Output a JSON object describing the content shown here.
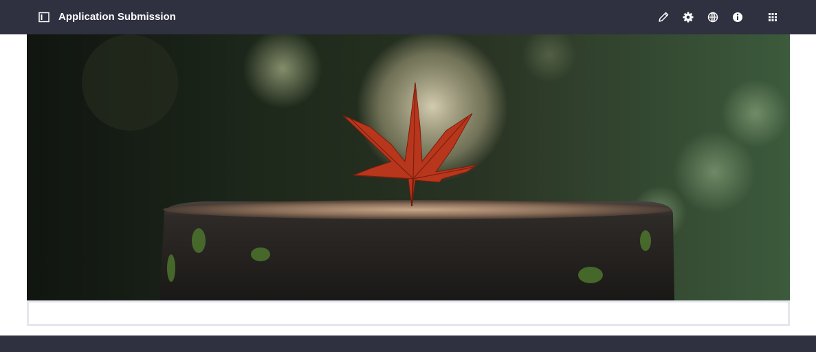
{
  "header": {
    "title": "Application Submission",
    "icons": {
      "sidebar_toggle": "sidebar-toggle-icon",
      "edit": "pencil-icon",
      "settings": "gear-icon",
      "language": "globe-icon",
      "info": "info-icon",
      "apps": "grid-icon"
    }
  },
  "banner": {
    "image": "red maple leaf on a mossy tree stump with bokeh green background"
  },
  "colors": {
    "topbar_bg": "#2f3040",
    "footer_bg": "#2f3040",
    "icon_color": "#ffffff",
    "content_border": "#e6e6ee"
  }
}
